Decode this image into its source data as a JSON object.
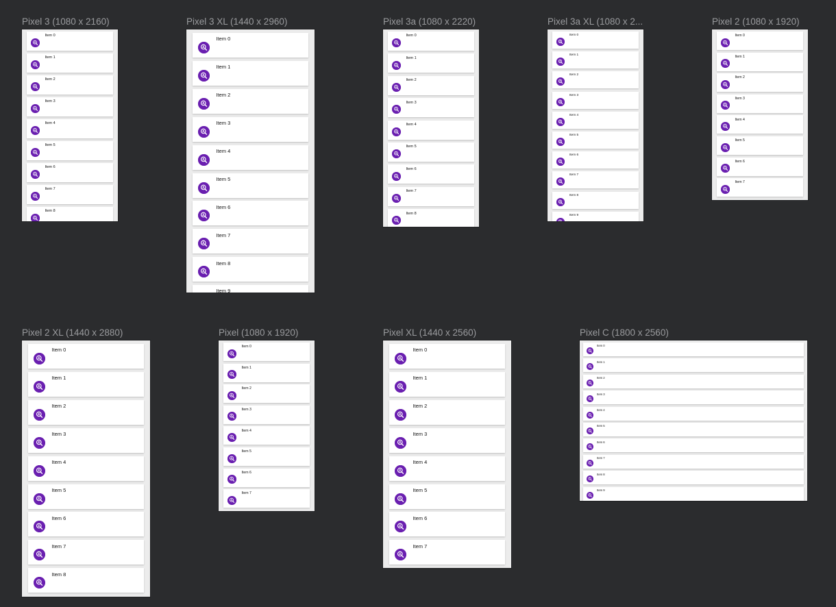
{
  "accent_color": "#6a1fb0",
  "background_color": "#2b2c2e",
  "item_icon": "search-person-icon",
  "devices": [
    {
      "id": "pixel-3",
      "label": "Pixel 3 (1080 x 2160)",
      "items": [
        "Item 0",
        "Item 1",
        "Item 2",
        "Item 3",
        "Item 4",
        "Item 5",
        "Item 6",
        "Item 7",
        "Item 8"
      ]
    },
    {
      "id": "pixel-3-xl",
      "label": "Pixel 3 XL (1440 x 2960)",
      "items": [
        "Item 0",
        "Item 1",
        "Item 2",
        "Item 3",
        "Item 4",
        "Item 5",
        "Item 6",
        "Item 7",
        "Item 8",
        "Item 9"
      ]
    },
    {
      "id": "pixel-3a",
      "label": "Pixel 3a (1080 x 2220)",
      "items": [
        "Item 0",
        "Item 1",
        "Item 2",
        "Item 3",
        "Item 4",
        "Item 5",
        "Item 6",
        "Item 7",
        "Item 8"
      ]
    },
    {
      "id": "pixel-3a-xl",
      "label": "Pixel 3a XL (1080 x 2...",
      "items": [
        "Item 0",
        "Item 1",
        "Item 2",
        "Item 3",
        "Item 4",
        "Item 5",
        "Item 6",
        "Item 7",
        "Item 8",
        "Item 9"
      ]
    },
    {
      "id": "pixel-2",
      "label": "Pixel 2 (1080 x 1920)",
      "items": [
        "Item 0",
        "Item 1",
        "Item 2",
        "Item 3",
        "Item 4",
        "Item 5",
        "Item 6",
        "Item 7"
      ]
    },
    {
      "id": "pixel-2-xl",
      "label": "Pixel 2 XL (1440 x 2880)",
      "items": [
        "Item 0",
        "Item 1",
        "Item 2",
        "Item 3",
        "Item 4",
        "Item 5",
        "Item 6",
        "Item 7",
        "Item 8"
      ]
    },
    {
      "id": "pixel",
      "label": "Pixel (1080 x 1920)",
      "items": [
        "Item 0",
        "Item 1",
        "Item 2",
        "Item 3",
        "Item 4",
        "Item 5",
        "Item 6",
        "Item 7"
      ]
    },
    {
      "id": "pixel-xl",
      "label": "Pixel XL (1440 x 2560)",
      "items": [
        "Item 0",
        "Item 1",
        "Item 2",
        "Item 3",
        "Item 4",
        "Item 5",
        "Item 6",
        "Item 7"
      ]
    },
    {
      "id": "pixel-c",
      "label": "Pixel C (1800 x 2560)",
      "items": [
        "Item 0",
        "Item 1",
        "Item 2",
        "Item 3",
        "Item 4",
        "Item 5",
        "Item 6",
        "Item 7",
        "Item 8",
        "Item 9"
      ]
    }
  ]
}
